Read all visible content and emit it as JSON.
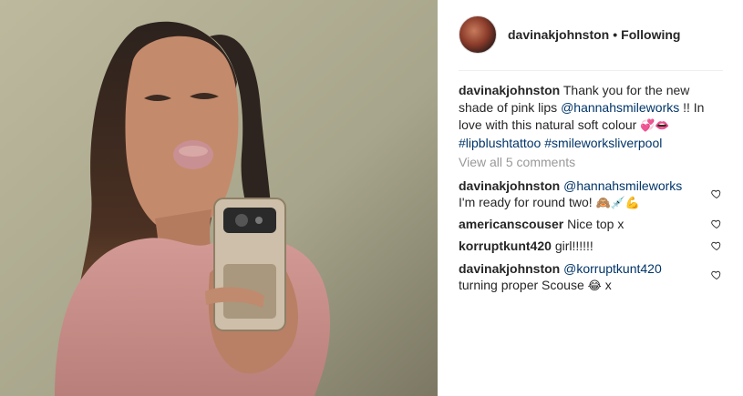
{
  "post": {
    "username": "davinakjohnston",
    "separator": "•",
    "follow_state": "Following"
  },
  "caption": {
    "username": "davinakjohnston",
    "text1": "Thank you for the new shade of pink lips ",
    "mention": "@hannahsmileworks",
    "text2": " !! In love with this natural soft colour ",
    "emojis": "💞👄",
    "hashtag1": "#lipblushtattoo",
    "hashtag2": "#smileworksliverpool"
  },
  "view_all_comments": "View all 5 comments",
  "comments": [
    {
      "username": "davinakjohnston",
      "mention": "@hannahsmileworks",
      "text": "I'm ready for round two! ",
      "emojis": "🙈💉💪"
    },
    {
      "username": "americanscouser",
      "text": "Nice top x"
    },
    {
      "username": "korruptkunt420",
      "text": "girl!!!!!!"
    },
    {
      "username": "davinakjohnston",
      "mention": "@korruptkunt420",
      "text": "turning proper Scouse ",
      "emojis": "😂",
      "text_after": " x"
    }
  ],
  "colors": {
    "link": "#003569",
    "muted": "#999999",
    "text": "#262626",
    "divider": "#efefef"
  },
  "icons": [
    "heart-icon"
  ]
}
